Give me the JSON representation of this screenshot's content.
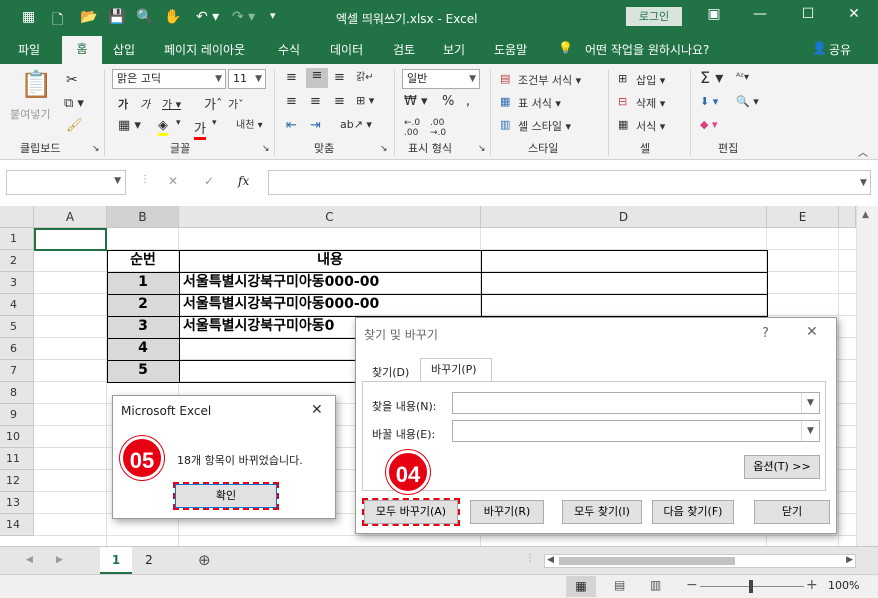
{
  "window": {
    "title": "엑셀 띄워쓰기.xlsx  -  Excel",
    "login": "로그인"
  },
  "menu": {
    "tabs": [
      "파일",
      "홈",
      "삽입",
      "페이지 레이아웃",
      "수식",
      "데이터",
      "검토",
      "보기",
      "도움말"
    ],
    "tell_me": "어떤 작업을 원하시나요?",
    "share": "공유"
  },
  "ribbon": {
    "clipboard": {
      "paste": "붙여넣기",
      "label": "클립보드"
    },
    "font": {
      "name": "맑은 고딕",
      "size": "11",
      "label": "글꼴"
    },
    "alignment": {
      "label": "맞춤"
    },
    "number": {
      "format": "일반",
      "label": "표시 형식"
    },
    "styles": {
      "cond": "조건부 서식",
      "table": "표 서식",
      "cell": "셀 스타일",
      "label": "스타일"
    },
    "cells": {
      "insert": "삽입",
      "delete": "삭제",
      "format": "서식",
      "label": "셀"
    },
    "editing": {
      "label": "편집"
    }
  },
  "formula_bar": {
    "fx": "fx",
    "cancel": "✕",
    "enter": "✓"
  },
  "sheet": {
    "columns": [
      "A",
      "B",
      "C",
      "D",
      "E"
    ],
    "rows": [
      "1",
      "2",
      "3",
      "4",
      "5",
      "6",
      "7",
      "8",
      "9",
      "10",
      "11",
      "12",
      "13",
      "14"
    ],
    "header": {
      "no": "순번",
      "content": "내용"
    },
    "data": [
      {
        "no": "1",
        "content": "서울특별시강북구미아동000-00"
      },
      {
        "no": "2",
        "content": "서울특별시강북구미아동000-00"
      },
      {
        "no": "3",
        "content": "서울특별시강북구미아동0"
      },
      {
        "no": "4",
        "content": ""
      },
      {
        "no": "5",
        "content": ""
      }
    ]
  },
  "sheet_tabs": [
    "1",
    "2"
  ],
  "status": {
    "zoom": "100%"
  },
  "find_dialog": {
    "title": "찾기 및 바꾸기",
    "help": "?",
    "tabs": [
      "찾기(D)",
      "바꾸기(P)"
    ],
    "find_label": "찾을 내용(N):",
    "replace_label": "바꿀 내용(E):",
    "find_value": "",
    "replace_value": "",
    "options": "옵션(T) >>",
    "buttons": {
      "replace_all": "모두 바꾸기(A)",
      "replace": "바꾸기(R)",
      "find_all": "모두 찾기(I)",
      "find_next": "다음 찾기(F)",
      "close": "닫기"
    }
  },
  "msg_dialog": {
    "title": "Microsoft Excel",
    "message": "18개 항목이 바뀌었습니다.",
    "ok": "확인"
  },
  "badges": {
    "b04": "04",
    "b05": "05"
  },
  "colors": {
    "excel_green": "#217346",
    "badge_red": "#e60012"
  }
}
